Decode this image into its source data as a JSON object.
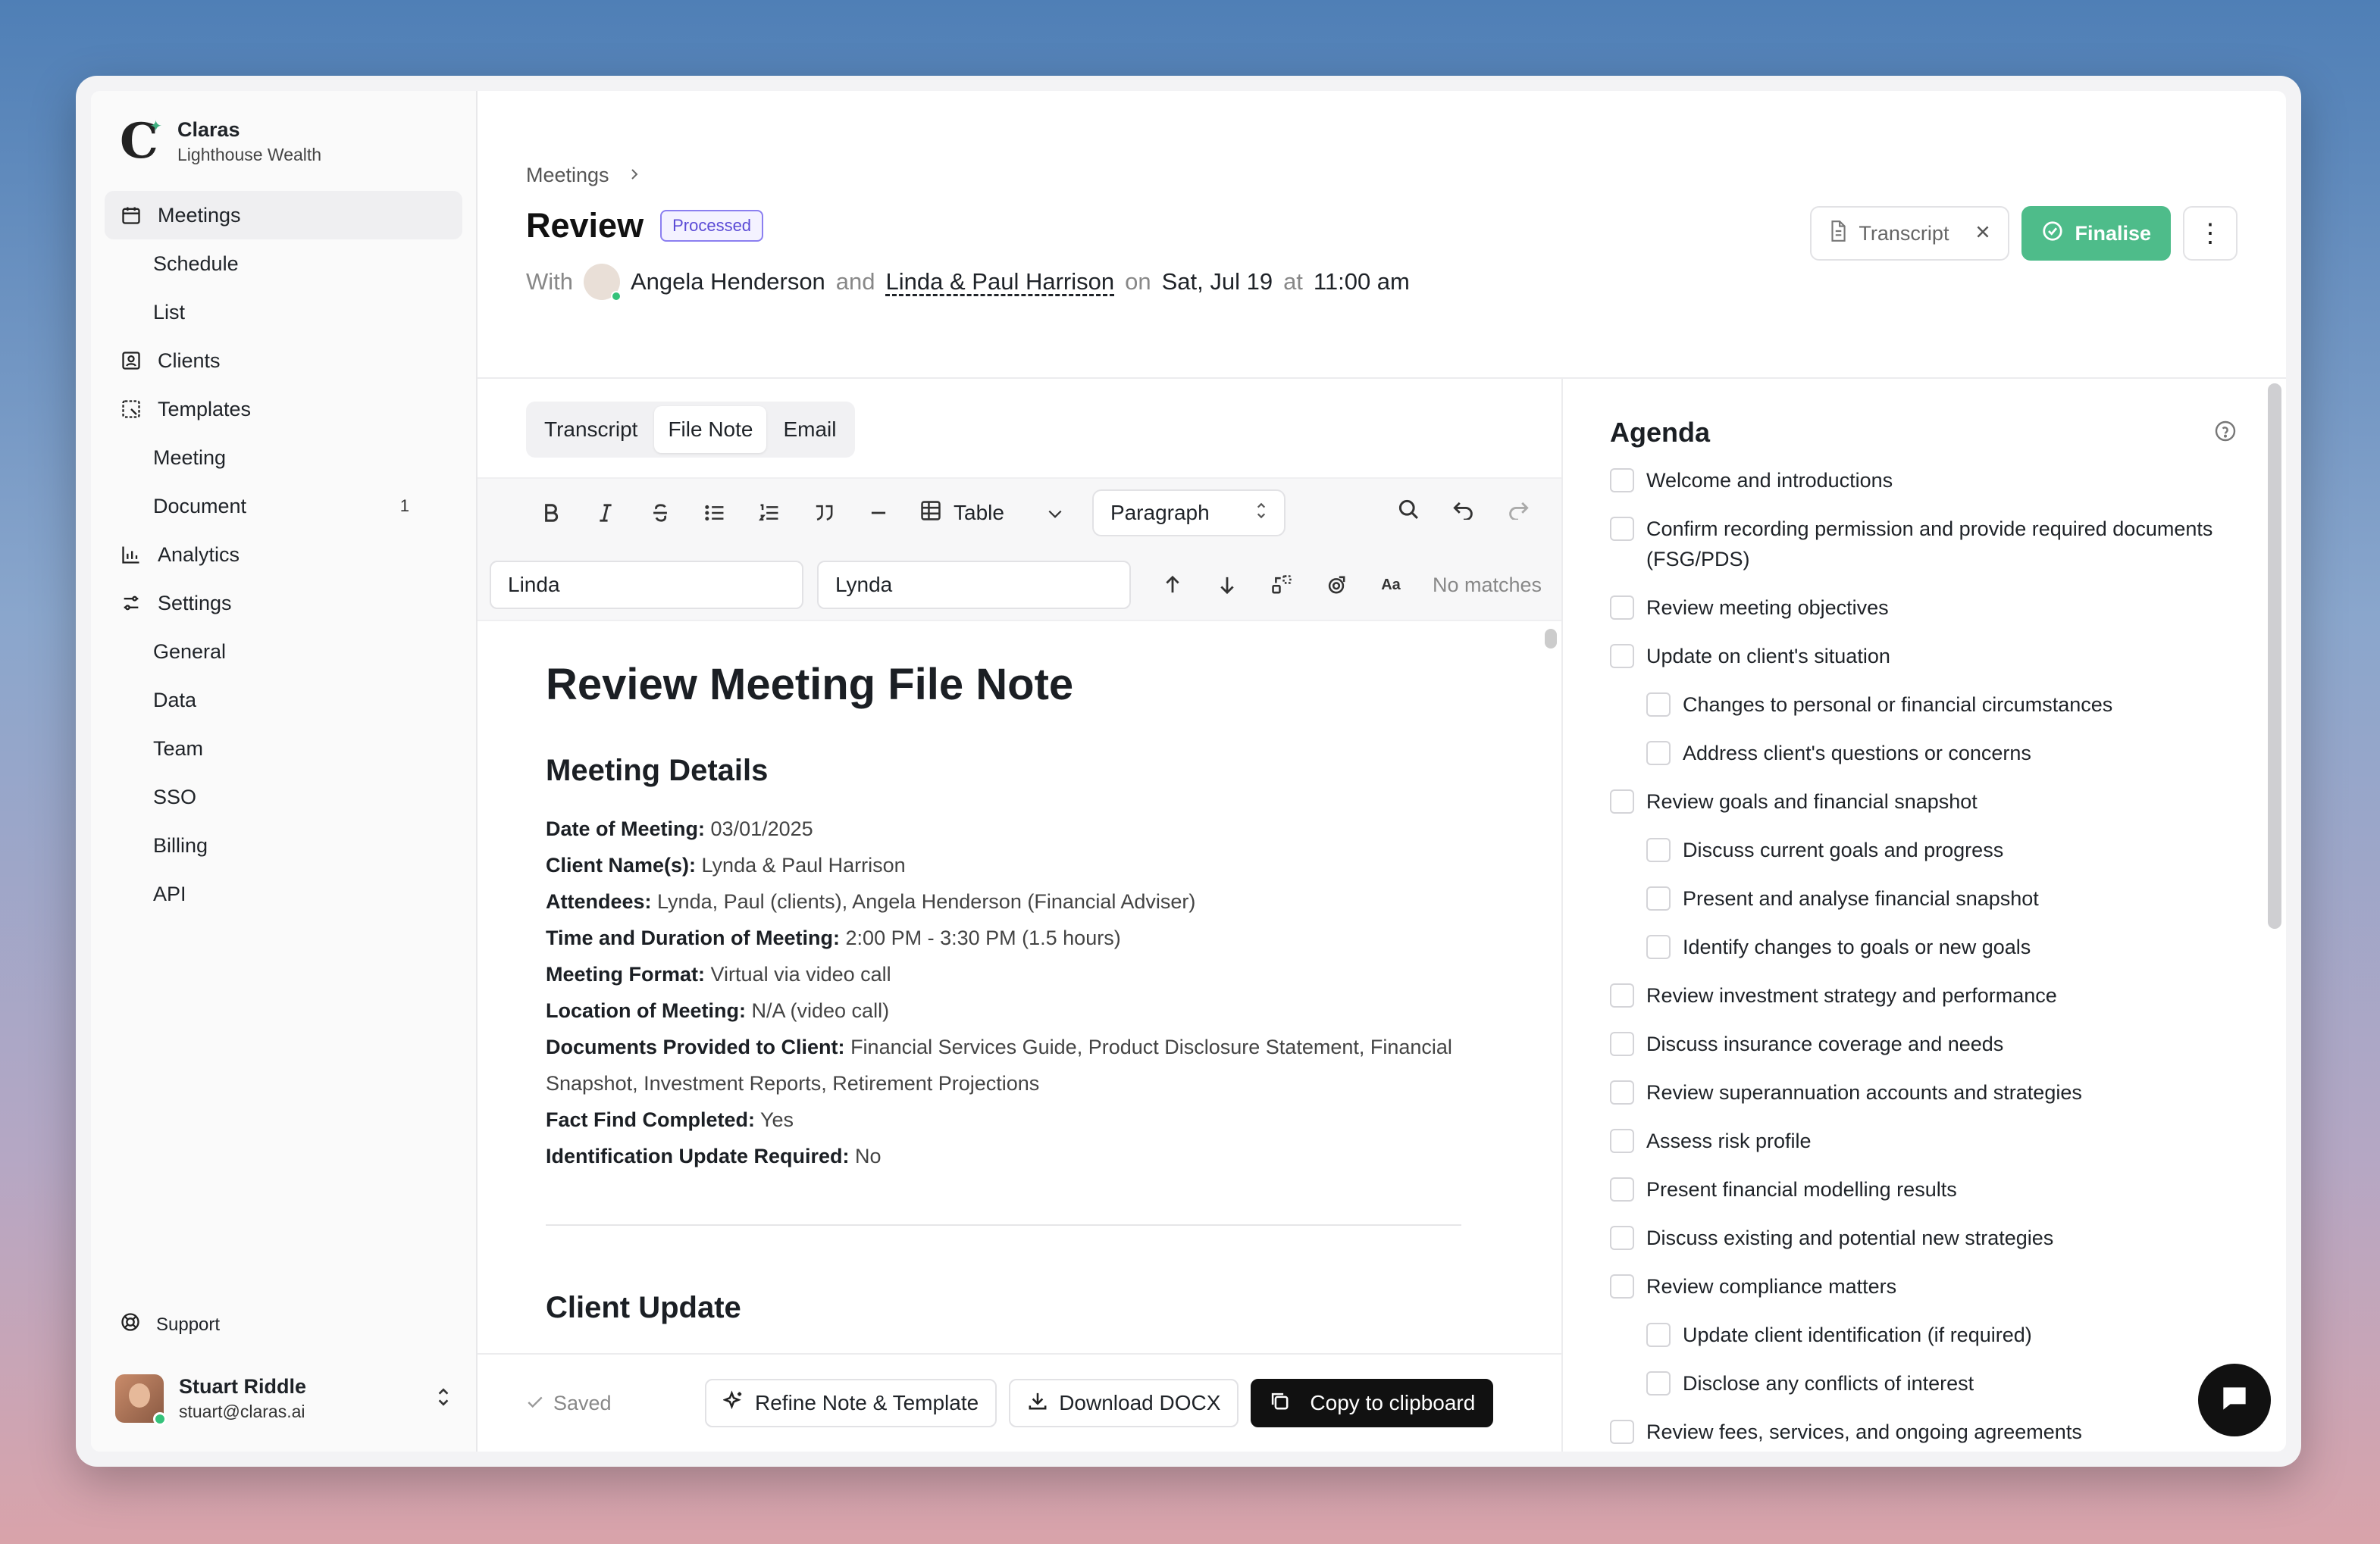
{
  "brand": {
    "name": "Claras",
    "org": "Lighthouse Wealth"
  },
  "sidebar": {
    "items": [
      {
        "label": "Meetings"
      },
      {
        "label": "Schedule"
      },
      {
        "label": "List"
      },
      {
        "label": "Clients"
      },
      {
        "label": "Templates"
      },
      {
        "label": "Meeting"
      },
      {
        "label": "Document",
        "count": "1"
      },
      {
        "label": "Analytics"
      },
      {
        "label": "Settings"
      },
      {
        "label": "General"
      },
      {
        "label": "Data"
      },
      {
        "label": "Team"
      },
      {
        "label": "SSO"
      },
      {
        "label": "Billing"
      },
      {
        "label": "API"
      }
    ],
    "support": "Support",
    "user": {
      "name": "Stuart Riddle",
      "email": "stuart@claras.ai"
    }
  },
  "header": {
    "breadcrumb": "Meetings",
    "title": "Review",
    "badge": "Processed",
    "with_label": "With",
    "adviser": "Angela Henderson",
    "and_label": "and",
    "clients": "Linda & Paul Harrison",
    "on_label": "on",
    "date": "Sat, Jul 19",
    "at_label": "at",
    "time": "11:00 am",
    "transcript_btn": "Transcript",
    "finalise_btn": "Finalise"
  },
  "editor": {
    "tabs": [
      "Transcript",
      "File Note",
      "Email"
    ],
    "active_tab": "File Note",
    "toolbar": {
      "table_label": "Table",
      "paragraph_label": "Paragraph"
    },
    "find_value": "Linda",
    "replace_value": "Lynda",
    "no_matches": "No matches",
    "doc": {
      "title": "Review Meeting File Note",
      "section1": "Meeting Details",
      "fields": [
        {
          "label": "Date of Meeting:",
          "value": "03/01/2025"
        },
        {
          "label": "Client Name(s):",
          "value": "Lynda & Paul Harrison"
        },
        {
          "label": "Attendees:",
          "value": "Lynda, Paul (clients), Angela Henderson (Financial Adviser)"
        },
        {
          "label": "Time and Duration of Meeting:",
          "value": "2:00 PM - 3:30 PM (1.5 hours)"
        },
        {
          "label": "Meeting Format:",
          "value": "Virtual via video call"
        },
        {
          "label": "Location of Meeting:",
          "value": "N/A (video call)"
        },
        {
          "label": "Documents Provided to Client:",
          "value": "Financial Services Guide, Product Disclosure Statement, Financial Snapshot, Investment Reports, Retirement Projections"
        },
        {
          "label": "Fact Find Completed:",
          "value": "Yes"
        },
        {
          "label": "Identification Update Required:",
          "value": "No"
        }
      ],
      "section2": "Client Update"
    },
    "footer": {
      "saved": "Saved",
      "refine": "Refine Note & Template",
      "download": "Download DOCX",
      "copy": "Copy to clipboard"
    }
  },
  "agenda": {
    "title": "Agenda",
    "items": [
      {
        "text": "Welcome and introductions",
        "sub": false
      },
      {
        "text": "Confirm recording permission and provide required documents (FSG/PDS)",
        "sub": false
      },
      {
        "text": "Review meeting objectives",
        "sub": false
      },
      {
        "text": "Update on client's situation",
        "sub": false
      },
      {
        "text": "Changes to personal or financial circumstances",
        "sub": true
      },
      {
        "text": "Address client's questions or concerns",
        "sub": true
      },
      {
        "text": "Review goals and financial snapshot",
        "sub": false
      },
      {
        "text": "Discuss current goals and progress",
        "sub": true
      },
      {
        "text": "Present and analyse financial snapshot",
        "sub": true
      },
      {
        "text": "Identify changes to goals or new goals",
        "sub": true
      },
      {
        "text": "Review investment strategy and performance",
        "sub": false
      },
      {
        "text": "Discuss insurance coverage and needs",
        "sub": false
      },
      {
        "text": "Review superannuation accounts and strategies",
        "sub": false
      },
      {
        "text": "Assess risk profile",
        "sub": false
      },
      {
        "text": "Present financial modelling results",
        "sub": false
      },
      {
        "text": "Discuss existing and potential new strategies",
        "sub": false
      },
      {
        "text": "Review compliance matters",
        "sub": false
      },
      {
        "text": "Update client identification (if required)",
        "sub": true
      },
      {
        "text": "Disclose any conflicts of interest",
        "sub": true
      },
      {
        "text": "Review fees, services, and ongoing agreements",
        "sub": false
      }
    ]
  },
  "colors": {
    "accent_green": "#4ebc8a",
    "badge_purple": "#5b4bd6"
  }
}
